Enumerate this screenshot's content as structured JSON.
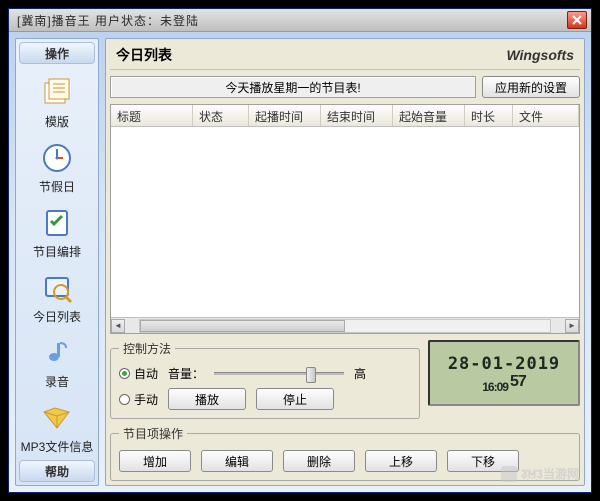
{
  "window": {
    "title": "[冀南]播音王 用户状态：未登陆"
  },
  "sidebar": {
    "header": "操作",
    "footer": "帮助",
    "items": [
      {
        "icon": "template-icon",
        "label": "模版"
      },
      {
        "icon": "holiday-icon",
        "label": "节假日"
      },
      {
        "icon": "schedule-icon",
        "label": "节目编排"
      },
      {
        "icon": "today-list-icon",
        "label": "今日列表"
      },
      {
        "icon": "record-icon",
        "label": "录音"
      },
      {
        "icon": "mp3-info-icon",
        "label": "MP3文件信息"
      }
    ]
  },
  "main": {
    "panel_title": "今日列表",
    "brand": "Wingsofts",
    "info_msg": "今天播放星期一的节目表!",
    "apply_btn": "应用新的设置",
    "columns": [
      "标题",
      "状态",
      "起播时间",
      "结束时间",
      "起始音量",
      "时长",
      "文件"
    ]
  },
  "control": {
    "legend": "控制方法",
    "radio_auto": "自动",
    "radio_manual": "手动",
    "volume_label": "音量：",
    "volume_high": "高",
    "play_btn": "播放",
    "stop_btn": "停止"
  },
  "lcd": {
    "date": "28-01-2019",
    "time_main": "16:09",
    "time_sec": "57"
  },
  "ops": {
    "legend": "节目项操作",
    "add": "增加",
    "edit": "编辑",
    "delete": "删除",
    "up": "上移",
    "down": "下移"
  },
  "watermark": "3҉H҉3当游网"
}
